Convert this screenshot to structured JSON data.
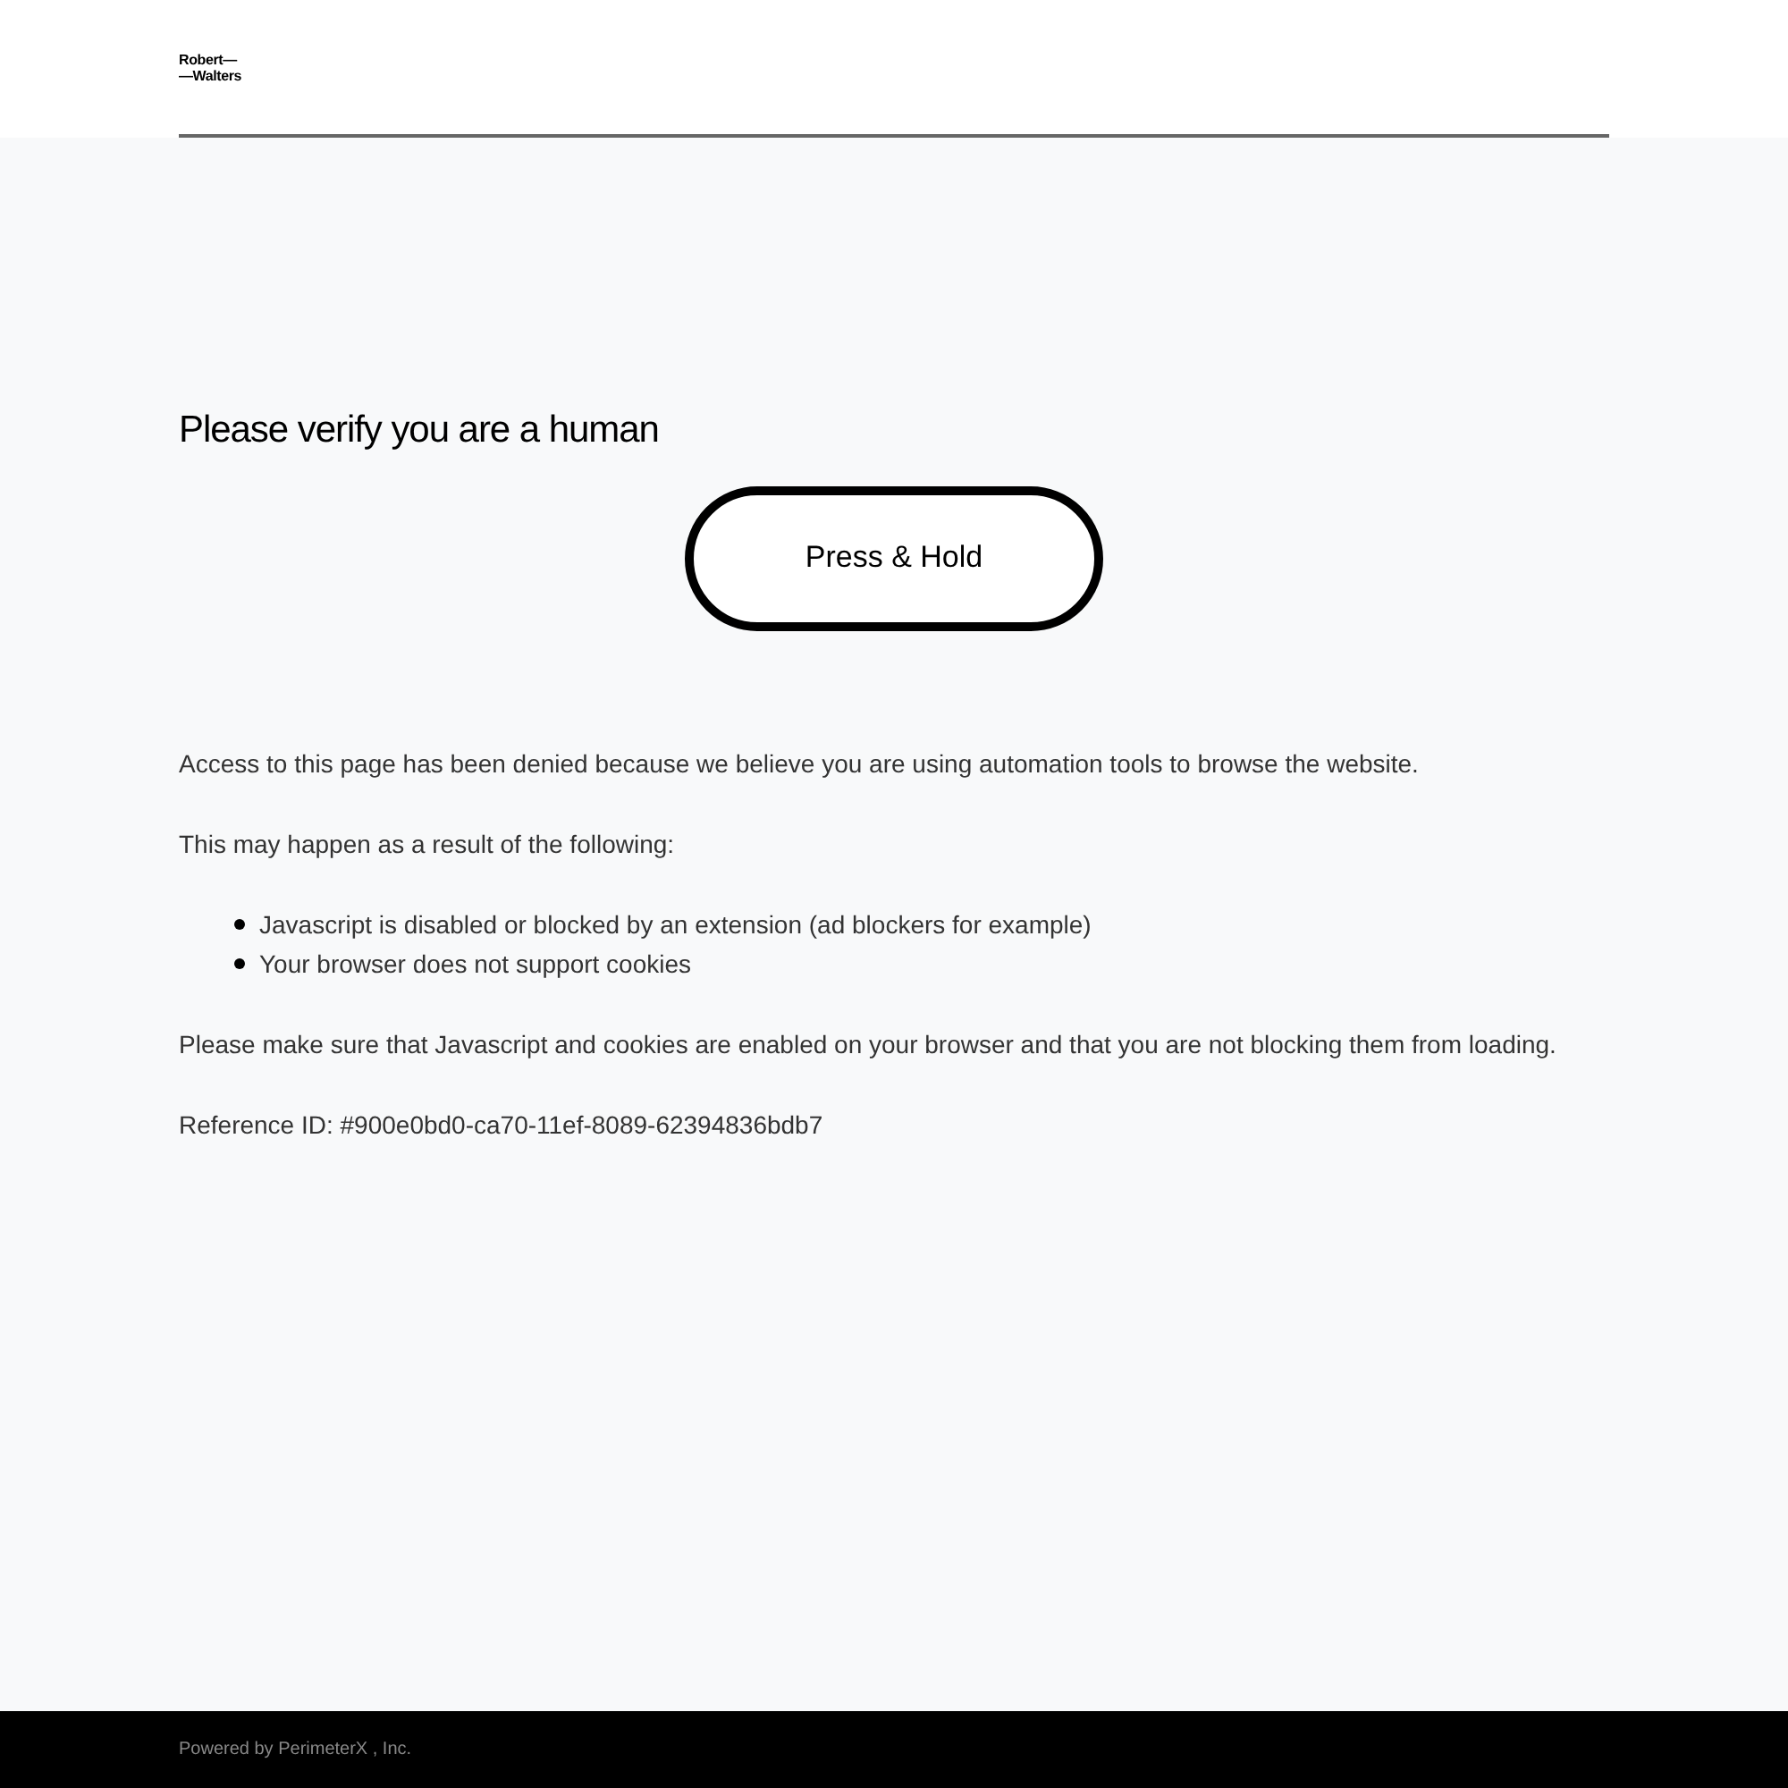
{
  "logo": {
    "lines": [
      "Robert—",
      "—Walters"
    ]
  },
  "heading": "Please verify you are a human",
  "button": "Press & Hold",
  "paragraphs": [
    "Access to this page has been denied because we believe you are using automation tools to browse the website.",
    "This may happen as a result of the following:"
  ],
  "reasons": [
    "Javascript is disabled or blocked by an extension (ad blockers for example)",
    "Your browser does not support cookies"
  ],
  "advice": "Please make sure that Javascript and cookies are enabled on your browser and that you are not blocking them from loading.",
  "reference": "Reference ID: #900e0bd0-ca70-11ef-8089-62394836bdb7",
  "footer": "Powered by PerimeterX , Inc."
}
